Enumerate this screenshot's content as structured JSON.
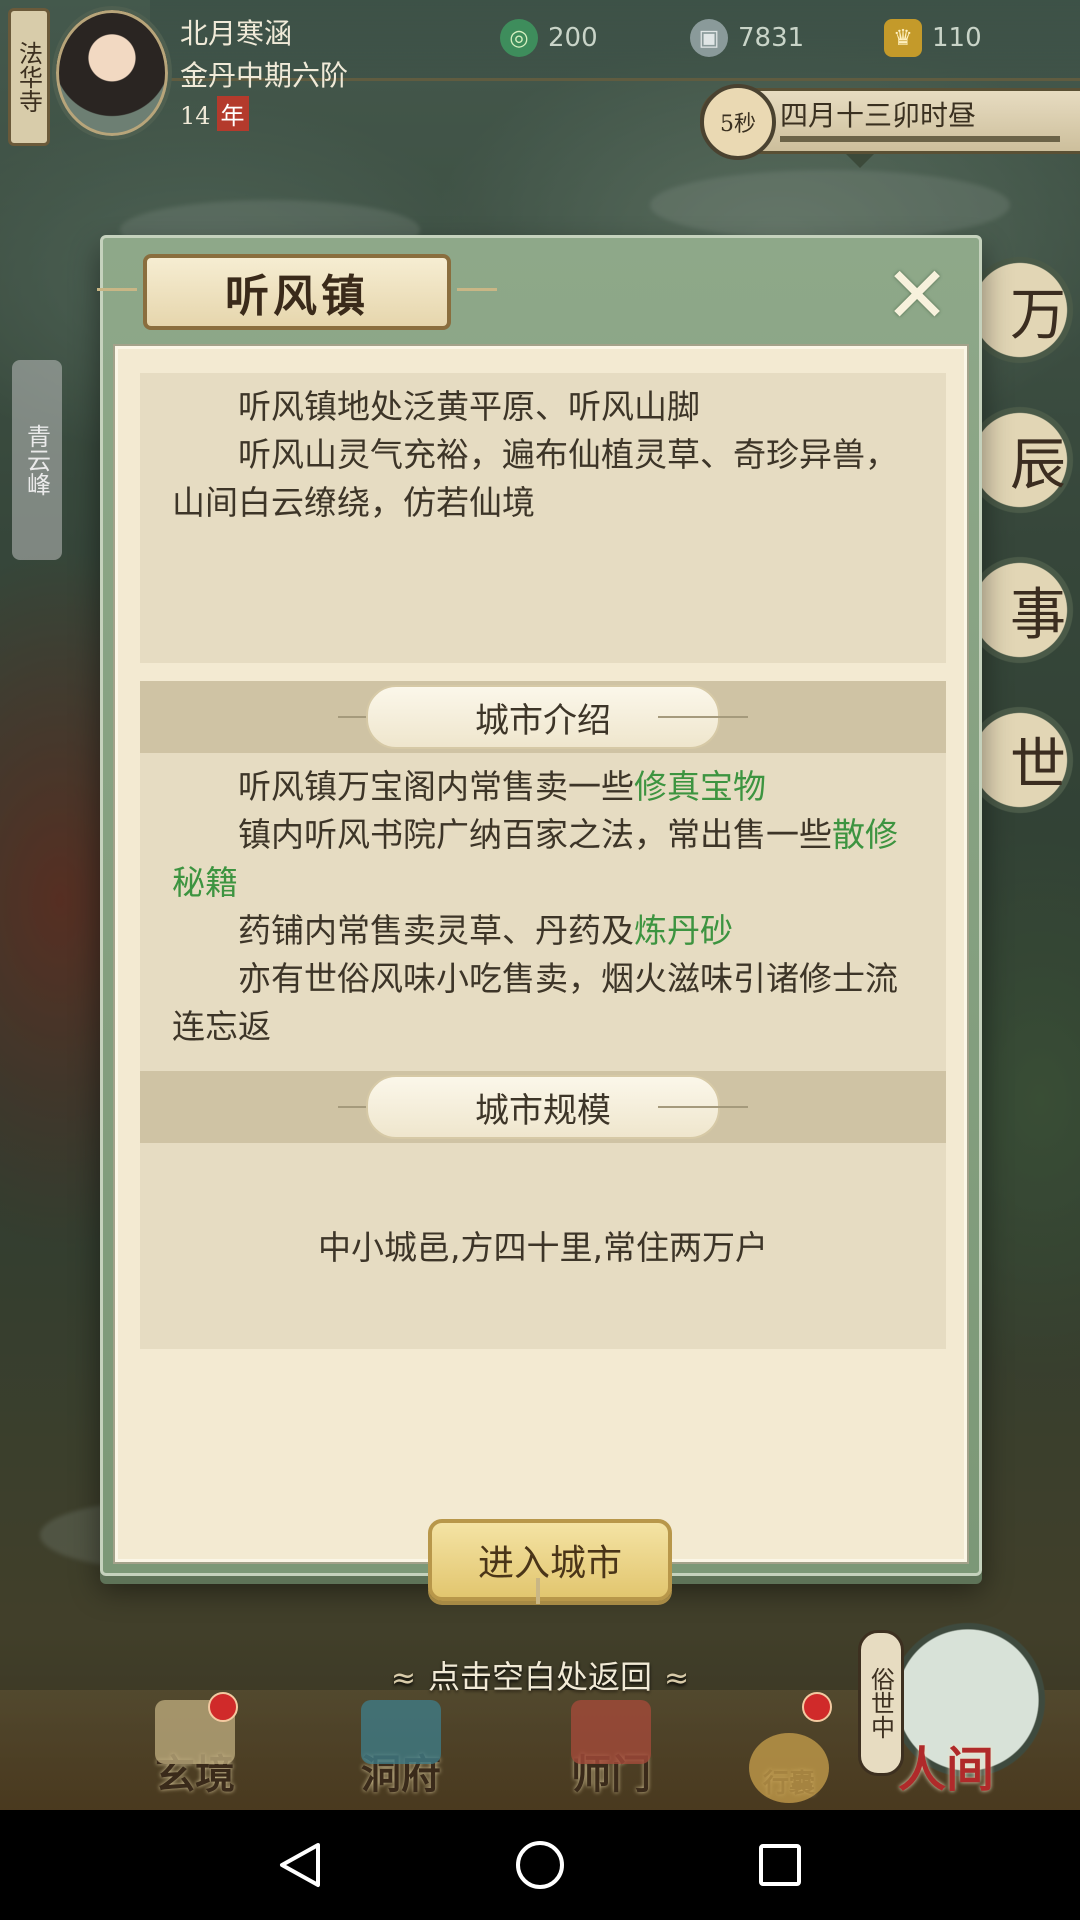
{
  "hud": {
    "sect_tag": "法华寺",
    "player_name": "北月寒涵",
    "player_realm": "金丹中期六阶",
    "player_age": "14",
    "age_unit": "年",
    "resources": [
      {
        "icon": "jade-swirl-icon",
        "value": "200"
      },
      {
        "icon": "coin-icon",
        "value": "7831"
      },
      {
        "icon": "gold-ingot-icon",
        "value": "110"
      }
    ],
    "timer_seconds": "5秒",
    "date_text": "四月十三卯时昼"
  },
  "side": {
    "left_label": "青云峰",
    "right_chars": [
      "万",
      "辰",
      "事",
      "世"
    ]
  },
  "dialog": {
    "title": "听风镇",
    "close_symbol": "✕",
    "description": [
      "听风镇地处泛黄平原、听风山脚",
      "听风山灵气充裕，遍布仙植灵草、奇珍异兽，山间白云缭绕，仿若仙境"
    ],
    "intro_header": "城市介绍",
    "intro": [
      {
        "pre": "听风镇万宝阁内常售卖一些",
        "hl": "修真宝物"
      },
      {
        "pre": "镇内听风书院广纳百家之法，常出售一些",
        "hl": "散修秘籍"
      },
      {
        "pre": "药铺内常售卖灵草、丹药及",
        "hl": "炼丹砂"
      },
      {
        "pre": "亦有世俗风味小吃售卖，烟火滋味引诸修士流连忘返",
        "hl": ""
      }
    ],
    "scale_header": "城市规模",
    "scale_text": "中小城邑,方四十里,常住两万户",
    "enter_button": "进入城市"
  },
  "bottom": {
    "back_hint": "点击空白处返回",
    "nav": [
      {
        "label": "玄境",
        "badge": true
      },
      {
        "label": "洞府",
        "badge": false
      },
      {
        "label": "师门",
        "badge": false
      },
      {
        "label": "行囊",
        "badge": true
      }
    ],
    "world_tag": "俗世中",
    "world_label": "人间"
  },
  "colors": {
    "highlight_green": "#3d9440",
    "dialog_frame": "#8ea889",
    "parchment": "#f3ead2"
  }
}
